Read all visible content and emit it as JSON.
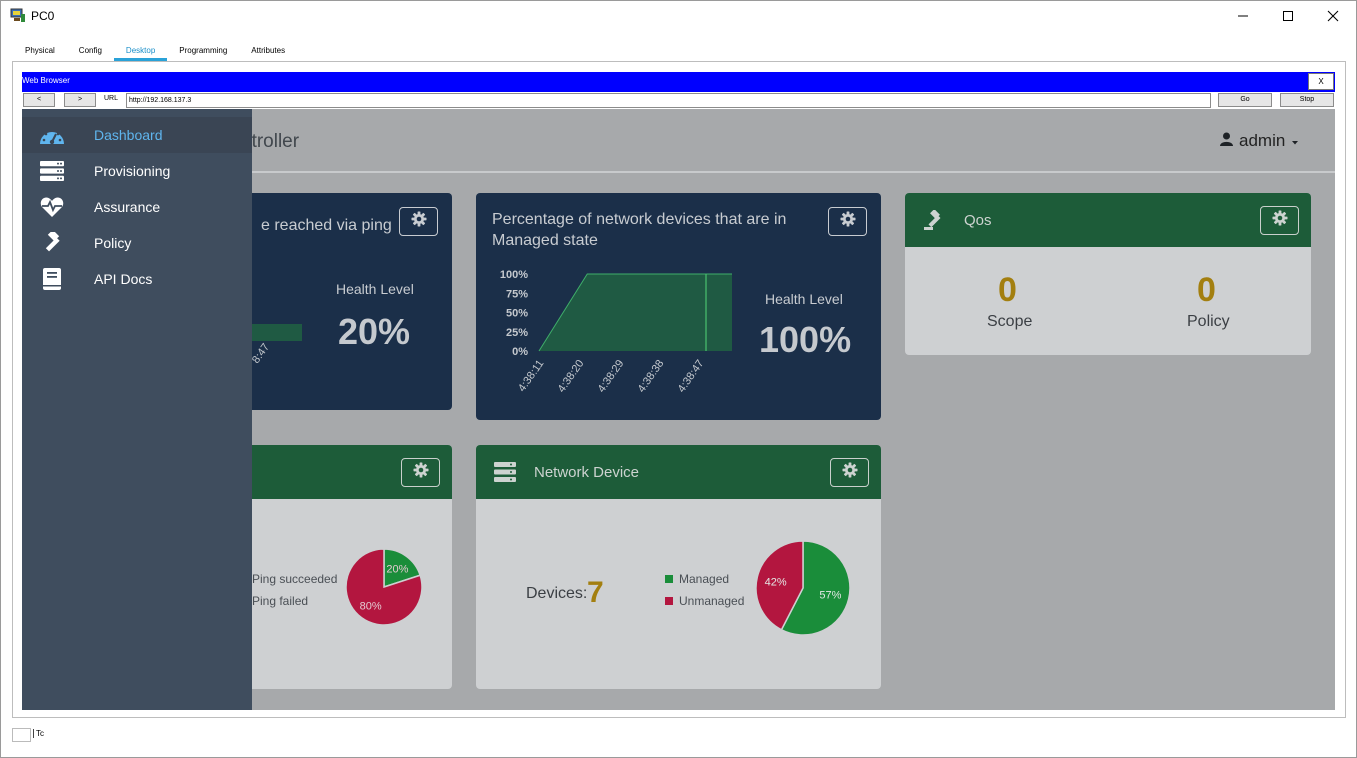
{
  "window": {
    "title": "PC0"
  },
  "tabs": [
    {
      "label": "Physical"
    },
    {
      "label": "Config"
    },
    {
      "label": "Desktop",
      "active": true
    },
    {
      "label": "Programming"
    },
    {
      "label": "Attributes"
    }
  ],
  "browser": {
    "title": "Web Browser",
    "close_label": "X",
    "back_label": "<",
    "forward_label": ">",
    "url_label": "URL",
    "url": "http://192.168.137.3",
    "go_label": "Go",
    "stop_label": "Stop"
  },
  "header": {
    "title": "ntroller",
    "user": "admin"
  },
  "sidebar": {
    "items": [
      {
        "label": "Dashboard",
        "icon": "dashboard-icon",
        "active": true
      },
      {
        "label": "Provisioning",
        "icon": "server-icon"
      },
      {
        "label": "Assurance",
        "icon": "heart-pulse-icon"
      },
      {
        "label": "Policy",
        "icon": "gavel-icon"
      },
      {
        "label": "API Docs",
        "icon": "book-icon"
      }
    ]
  },
  "cards": {
    "ping_reach": {
      "title": "e reached via ping",
      "tick": "8:47",
      "health_label": "Health Level",
      "health_value": "20%"
    },
    "managed_state": {
      "title_line1": "Percentage of network devices that are in",
      "title_line2": "Managed state",
      "health_label": "Health Level",
      "health_value": "100%"
    },
    "qos": {
      "title": "Qos",
      "scope_value": "0",
      "scope_label": "Scope",
      "policy_value": "0",
      "policy_label": "Policy"
    },
    "host": {
      "legend": [
        {
          "label": "Ping succeeded",
          "color": "#1a8d3a"
        },
        {
          "label": "Ping failed",
          "color": "#b3163f"
        }
      ],
      "pie": [
        {
          "label": "20%",
          "value": 20,
          "color": "#1a8d3a"
        },
        {
          "label": "80%",
          "value": 80,
          "color": "#b3163f"
        }
      ]
    },
    "network_device": {
      "title": "Network Device",
      "devices_label": "Devices:",
      "devices_value": "7",
      "legend": [
        {
          "label": "Managed",
          "color": "#1a8d3a"
        },
        {
          "label": "Unmanaged",
          "color": "#b3163f"
        }
      ],
      "pie": [
        {
          "label": "57%",
          "value": 57,
          "color": "#1a8d3a"
        },
        {
          "label": "42%",
          "value": 42,
          "color": "#b3163f"
        }
      ]
    }
  },
  "chart_data": {
    "type": "area",
    "x": [
      "4:38:11",
      "4:38:20",
      "4:38:29",
      "4:38:38",
      "4:38:47"
    ],
    "series": [
      {
        "values": [
          0,
          100,
          100,
          100,
          100
        ]
      }
    ],
    "yticks": [
      "100%",
      "75%",
      "50%",
      "25%",
      "0%"
    ],
    "ylim": [
      0,
      100
    ],
    "color": "#1f5a43"
  },
  "statusbar": {
    "text": "Tc"
  },
  "colors": {
    "navy_card": "#1b2f49",
    "green_header": "#1d5c39",
    "sidebar": "#3f4d5e",
    "active_link": "#5fb5ee",
    "gold_number": "#a37f10",
    "title_bar_blue": "#0000ff"
  }
}
